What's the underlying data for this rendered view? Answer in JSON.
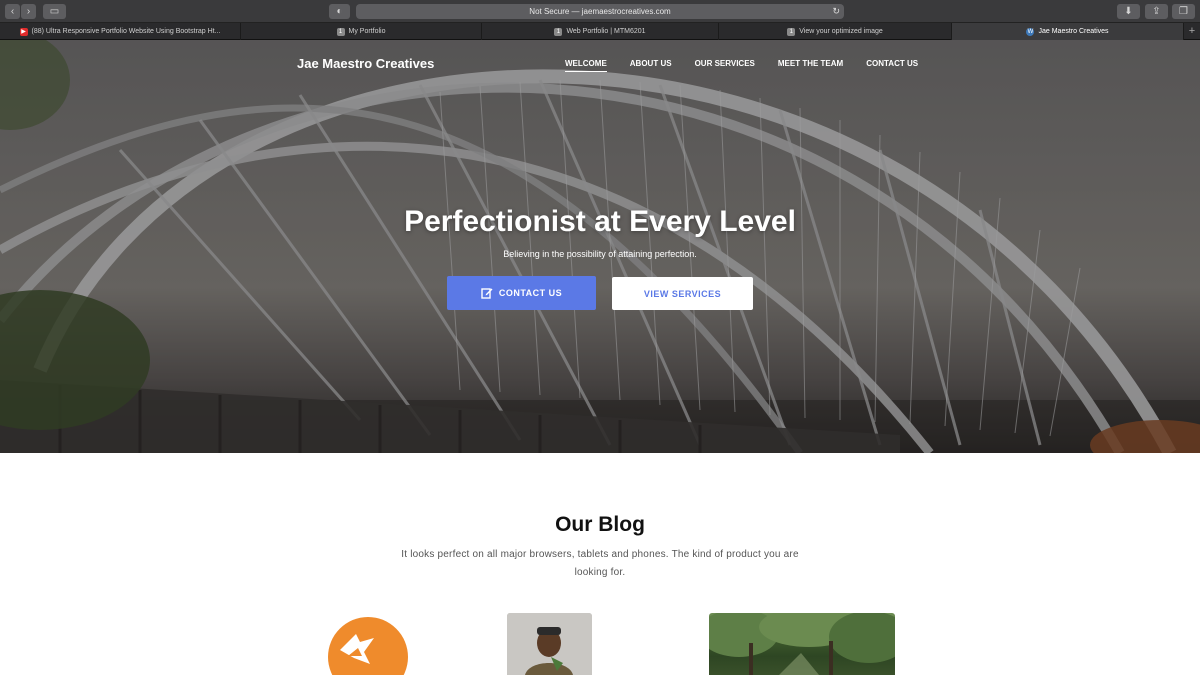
{
  "browser": {
    "address": "Not Secure — jaemaestrocreatives.com",
    "tabs": [
      {
        "label": "(88) Ultra Responsive Portfolio Website Using Bootstrap Ht...",
        "icon": "youtube-icon",
        "active": false
      },
      {
        "label": "My Portfolio",
        "icon": "page-icon",
        "active": false
      },
      {
        "label": "Web Portfolio | MTM6201",
        "icon": "page-icon",
        "active": false
      },
      {
        "label": "View your optimized image",
        "icon": "page-icon",
        "active": false
      },
      {
        "label": "Jae Maestro Creatives",
        "icon": "wordpress-icon",
        "active": true
      }
    ]
  },
  "site": {
    "brand": "Jae Maestro Creatives",
    "nav": [
      "WELCOME",
      "ABOUT US",
      "OUR SERVICES",
      "MEET THE TEAM",
      "CONTACT US"
    ],
    "hero": {
      "title": "Perfectionist at Every Level",
      "subtitle": "Believing in the possibility of attaining perfection.",
      "contact_button": "CONTACT US",
      "view_button": "VIEW SERVICES"
    },
    "blog": {
      "title": "Our Blog",
      "description": "It looks perfect on all major browsers, tablets and phones. The kind of product you are looking for."
    }
  },
  "colors": {
    "accent": "#5b79e6",
    "logo_orange": "#ef8b2c"
  }
}
